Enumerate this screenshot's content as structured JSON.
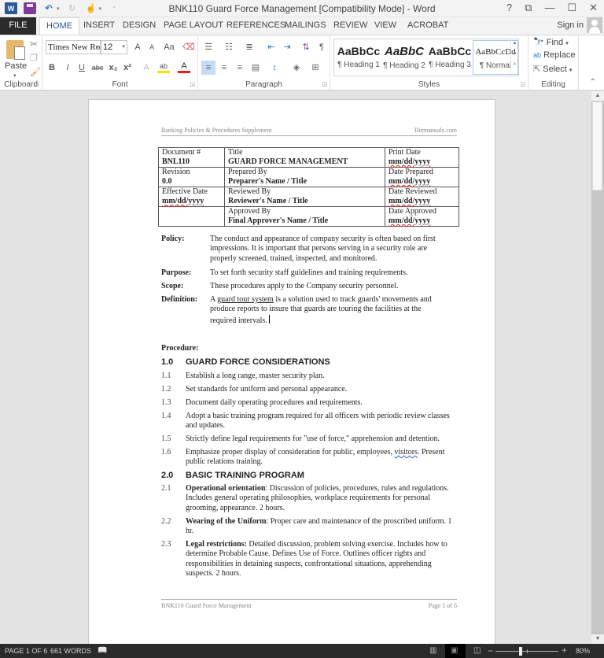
{
  "window": {
    "title": "BNK110 Guard Force Management [Compatibility Mode] - Word",
    "controls": [
      "?",
      "⧉",
      "—",
      "☐",
      "✕"
    ]
  },
  "quick_access": {
    "icons": [
      "word-icon",
      "save-icon",
      "undo-icon",
      "redo-icon",
      "touch-mode-icon",
      "customize-icon"
    ]
  },
  "tabs": {
    "file": "FILE",
    "items": [
      "HOME",
      "INSERT",
      "DESIGN",
      "PAGE LAYOUT",
      "REFERENCES",
      "MAILINGS",
      "REVIEW",
      "VIEW",
      "ACROBAT"
    ],
    "active": "HOME",
    "sign_in": "Sign in"
  },
  "ribbon": {
    "clipboard": {
      "label": "Clipboard",
      "paste": "Paste"
    },
    "font": {
      "label": "Font",
      "font_name": "Times New Ro",
      "font_size": "12",
      "grow": "A",
      "shrink": "A",
      "change_case": "Aa",
      "bold": "B",
      "italic": "I",
      "underline": "U",
      "strikethrough": "abc",
      "subscript": "x₂",
      "superscript": "x²",
      "text_effects": "A",
      "highlight": "ab",
      "font_color": "A",
      "highlight_color": "#f5e000",
      "font_color_value": "#e02020"
    },
    "paragraph": {
      "label": "Paragraph"
    },
    "styles": {
      "label": "Styles",
      "items": [
        {
          "preview": "AaBbCc",
          "name": "¶ Heading 1"
        },
        {
          "preview": "AaBbC",
          "name": "¶ Heading 2"
        },
        {
          "preview": "AaBbCc",
          "name": "¶ Heading 3"
        },
        {
          "preview": "AaBbCcDd",
          "name": "¶ Normal"
        }
      ]
    },
    "editing": {
      "label": "Editing",
      "find": "Find",
      "replace": "Replace",
      "select": "Select"
    }
  },
  "document": {
    "header_left": "Banking Policies & Procedures Supplement",
    "header_right": "Bizmanualz.com",
    "meta": [
      [
        {
          "label": "Document #",
          "value": "BNL110"
        },
        {
          "label": "Title",
          "value": "GUARD FORCE MANAGEMENT"
        },
        {
          "label": "Print Date",
          "value": "mm/dd/yyyy"
        }
      ],
      [
        {
          "label": "Revision",
          "value": "0.0"
        },
        {
          "label": "Prepared By",
          "value": "Preparer's Name / Title"
        },
        {
          "label": "Date Prepared",
          "value": "mm/dd/yyyy"
        }
      ],
      [
        {
          "label": "Effective Date",
          "value": "mm/dd/yyyy"
        },
        {
          "label": "Reviewed By",
          "value": "Reviewer's Name / Title"
        },
        {
          "label": "Date Reviewed",
          "value": "mm/dd/yyyy"
        }
      ],
      [
        {
          "label": "",
          "value": ""
        },
        {
          "label": "Approved By",
          "value": "Final Approver's Name / Title"
        },
        {
          "label": "Date Approved",
          "value": "mm/dd/yyyy"
        }
      ]
    ],
    "policy": {
      "label": "Policy:",
      "text": "The conduct and appearance of company security is often based on first impressions.  It is important that persons serving in a security role are properly screened, trained, inspected, and monitored."
    },
    "purpose": {
      "label": "Purpose:",
      "text": "To set forth security staff guidelines and training requirements."
    },
    "scope": {
      "label": "Scope:",
      "text": "These procedures apply to the Company security personnel."
    },
    "definition": {
      "label": "Definition:",
      "prefix": "A ",
      "term": "guard tour system",
      "text": " is a solution used to track guards' movements and produce reports to insure that guards are touring the facilities at the required intervals."
    },
    "procedure_label": "Procedure:",
    "sections": [
      {
        "num": "1.0",
        "title": "GUARD FORCE CONSIDERATIONS",
        "items": [
          {
            "num": "1.1",
            "text": "Establish a long range, master security plan."
          },
          {
            "num": "1.2",
            "text": "Set standards for uniform and personal appearance."
          },
          {
            "num": "1.3",
            "text": "Document daily operating procedures and requirements."
          },
          {
            "num": "1.4",
            "text": "Adopt a basic training program required for all officers with periodic review classes and updates."
          },
          {
            "num": "1.5",
            "text": "Strictly define legal requirements for \"use of force,\" apprehension and detention."
          },
          {
            "num": "1.6",
            "text_before": "Emphasize proper display of consideration for public, employees, ",
            "flag": "visitors",
            "text_after": ".  Present public relations training."
          }
        ]
      },
      {
        "num": "2.0",
        "title": "BASIC TRAINING PROGRAM",
        "items": [
          {
            "num": "2.1",
            "bold": "Operational orientation",
            "text": ":  Discussion of policies, procedures, rules and regulations.  Includes general operating philosophies, workplace requirements for personal grooming, appearance. 2 hours."
          },
          {
            "num": "2.2",
            "bold": "Wearing of the Uniform",
            "text": ":  Proper care and maintenance of the proscribed uniform.  1 hr."
          },
          {
            "num": "2.3",
            "bold": "Legal restrictions:",
            "text": "  Detailed discussion, problem solving exercise.  Includes how to determine Probable Cause.  Defines Use of Force.  Outlines officer rights and responsibilities in detaining suspects, confrontational situations, apprehending suspects.  2 hours."
          }
        ]
      }
    ],
    "footer_left": "BNK110 Guard Force Management",
    "footer_right": "Page 1 of 6"
  },
  "status_bar": {
    "page": "PAGE 1 OF 6",
    "words": "661 WORDS",
    "zoom_percent": "80%",
    "zoom_value": 80
  }
}
